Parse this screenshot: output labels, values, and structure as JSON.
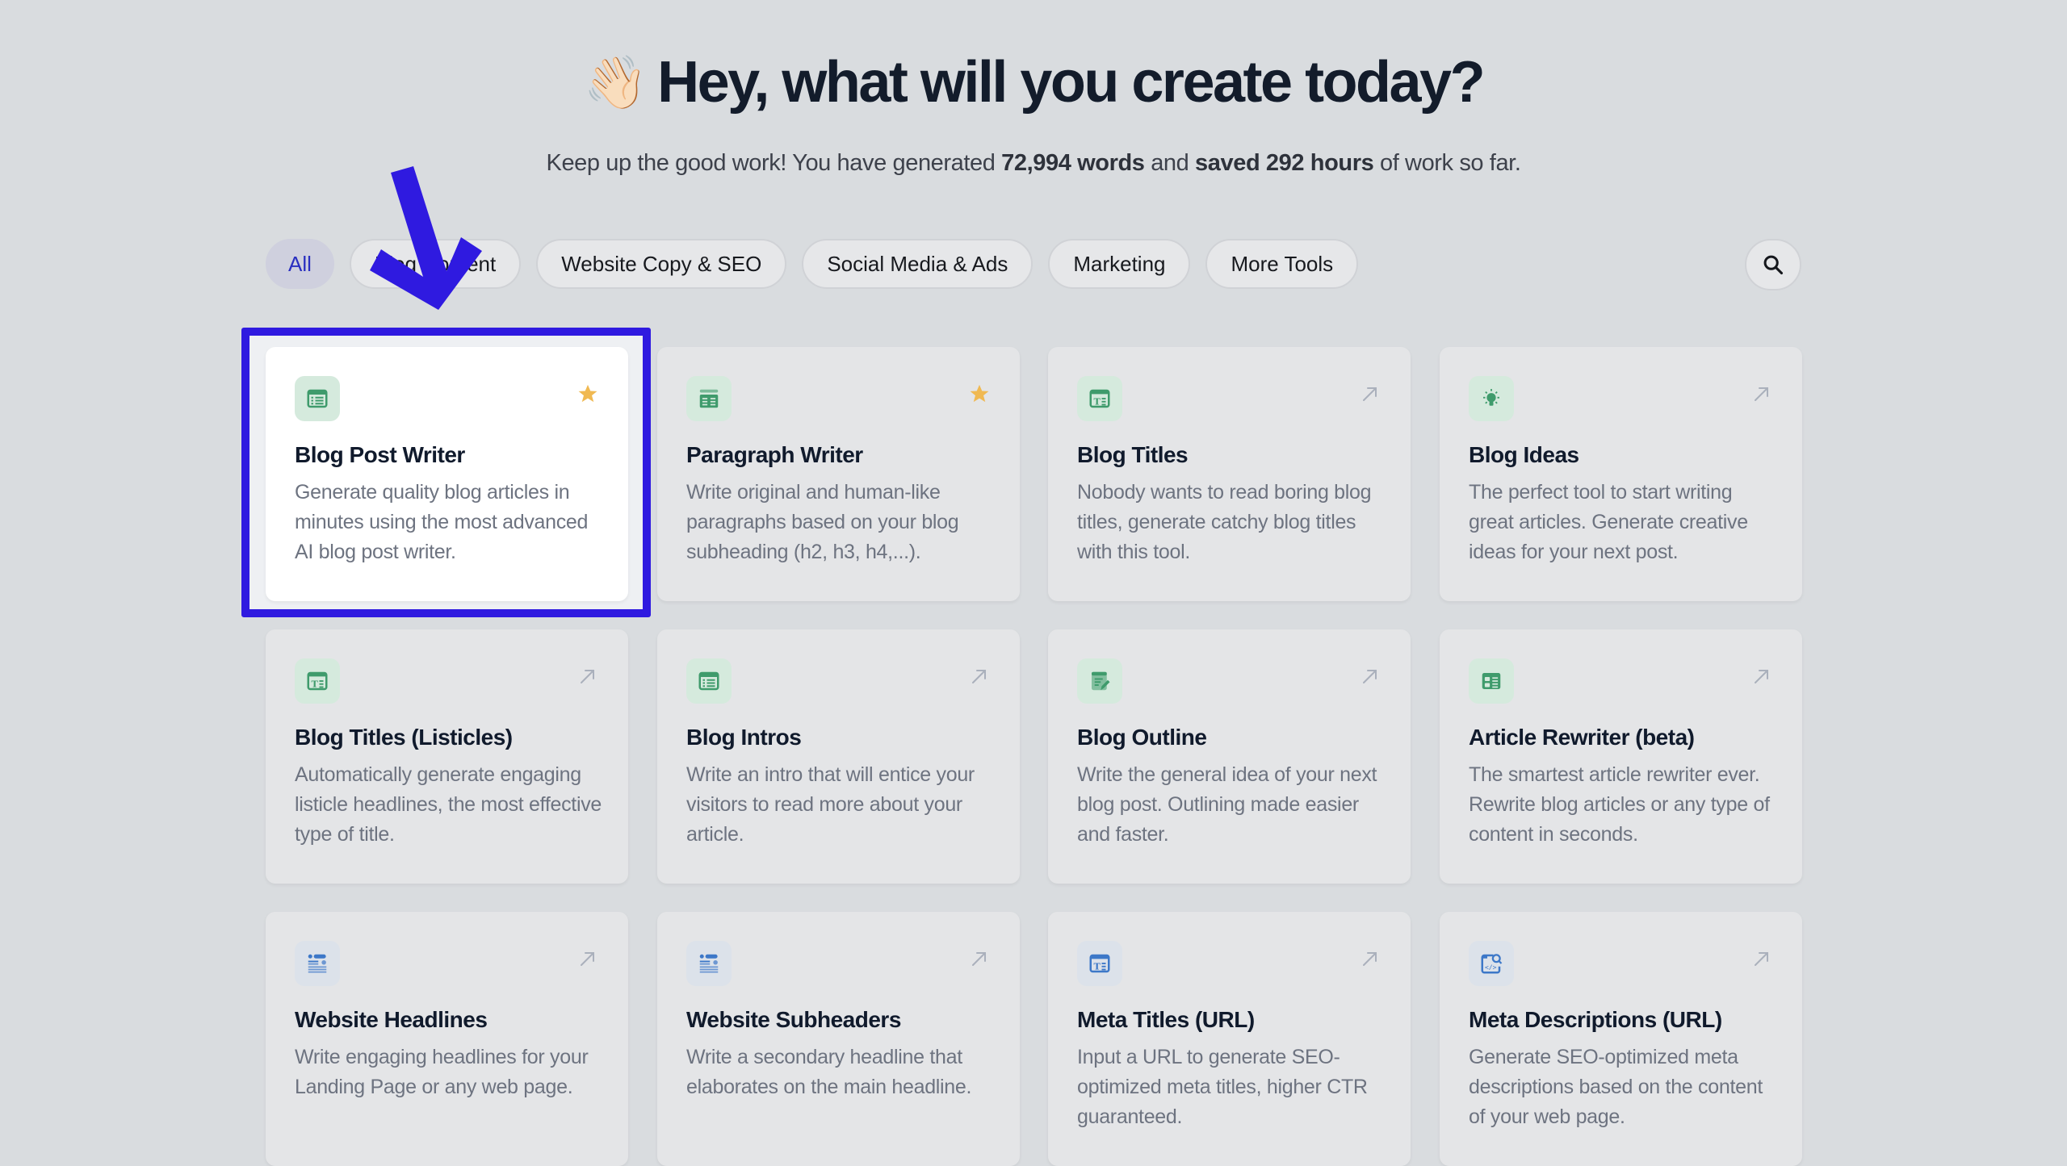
{
  "header": {
    "wave_emoji": "👋🏻",
    "title": "Hey, what will you create today?",
    "subtitle_prefix": "Keep up the good work! You have generated ",
    "words_generated": "72,994 words",
    "subtitle_middle": " and ",
    "hours_saved": "saved 292 hours",
    "subtitle_suffix": " of work so far."
  },
  "filters": [
    {
      "label": "All",
      "active": true
    },
    {
      "label": "Blog Content",
      "active": false
    },
    {
      "label": "Website Copy & SEO",
      "active": false
    },
    {
      "label": "Social Media & Ads",
      "active": false
    },
    {
      "label": "Marketing",
      "active": false
    },
    {
      "label": "More Tools",
      "active": false
    }
  ],
  "search": {
    "icon": "search-icon"
  },
  "colors": {
    "accent": "#2a2fc0",
    "annotation": "#2f1ae0",
    "star": "#f0b952",
    "icon_green": "#3f9b6c",
    "icon_blue": "#3d78c8",
    "link_arrow": "#aab0bc"
  },
  "tools": [
    {
      "title": "Blog Post Writer",
      "description": "Generate quality blog articles in minutes using the most advanced AI blog post writer.",
      "icon": "document-list-icon",
      "icon_color": "green",
      "favorite": true,
      "selected": true
    },
    {
      "title": "Paragraph Writer",
      "description": "Write original and human-like paragraphs based on your blog subheading (h2, h3, h4,...).",
      "icon": "paragraph-table-icon",
      "icon_color": "green",
      "favorite": true,
      "selected": false
    },
    {
      "title": "Blog Titles",
      "description": "Nobody wants to read boring blog titles, generate catchy blog titles with this tool.",
      "icon": "title-text-icon",
      "icon_color": "green",
      "favorite": false,
      "selected": false
    },
    {
      "title": "Blog Ideas",
      "description": "The perfect tool to start writing great articles. Generate creative ideas for your next post.",
      "icon": "lightbulb-icon",
      "icon_color": "green",
      "favorite": false,
      "selected": false
    },
    {
      "title": "Blog Titles (Listicles)",
      "description": "Automatically generate engaging listicle headlines, the most effective type of title.",
      "icon": "title-text-icon",
      "icon_color": "green",
      "favorite": false,
      "selected": false
    },
    {
      "title": "Blog Intros",
      "description": "Write an intro that will entice your visitors to read more about your article.",
      "icon": "document-list-icon",
      "icon_color": "green",
      "favorite": false,
      "selected": false
    },
    {
      "title": "Blog Outline",
      "description": "Write the general idea of your next blog post. Outlining made easier and faster.",
      "icon": "document-edit-icon",
      "icon_color": "green",
      "favorite": false,
      "selected": false
    },
    {
      "title": "Article Rewriter (beta)",
      "description": "The smartest article rewriter ever. Rewrite blog articles or any type of content in seconds.",
      "icon": "columns-layout-icon",
      "icon_color": "green",
      "favorite": false,
      "selected": false
    },
    {
      "title": "Website Headlines",
      "description": "Write engaging headlines for your Landing Page or any web page.",
      "icon": "webpage-layout-icon",
      "icon_color": "blue",
      "favorite": false,
      "selected": false
    },
    {
      "title": "Website Subheaders",
      "description": "Write a secondary headline that elaborates on the main headline.",
      "icon": "webpage-layout-icon",
      "icon_color": "blue",
      "favorite": false,
      "selected": false
    },
    {
      "title": "Meta Titles (URL)",
      "description": "Input a URL to generate SEO-optimized meta titles, higher CTR guaranteed.",
      "icon": "title-text-icon",
      "icon_color": "blue",
      "favorite": false,
      "selected": false
    },
    {
      "title": "Meta Descriptions (URL)",
      "description": "Generate SEO-optimized meta descriptions based on the content of your web page.",
      "icon": "code-search-icon",
      "icon_color": "blue",
      "favorite": false,
      "selected": false
    }
  ]
}
